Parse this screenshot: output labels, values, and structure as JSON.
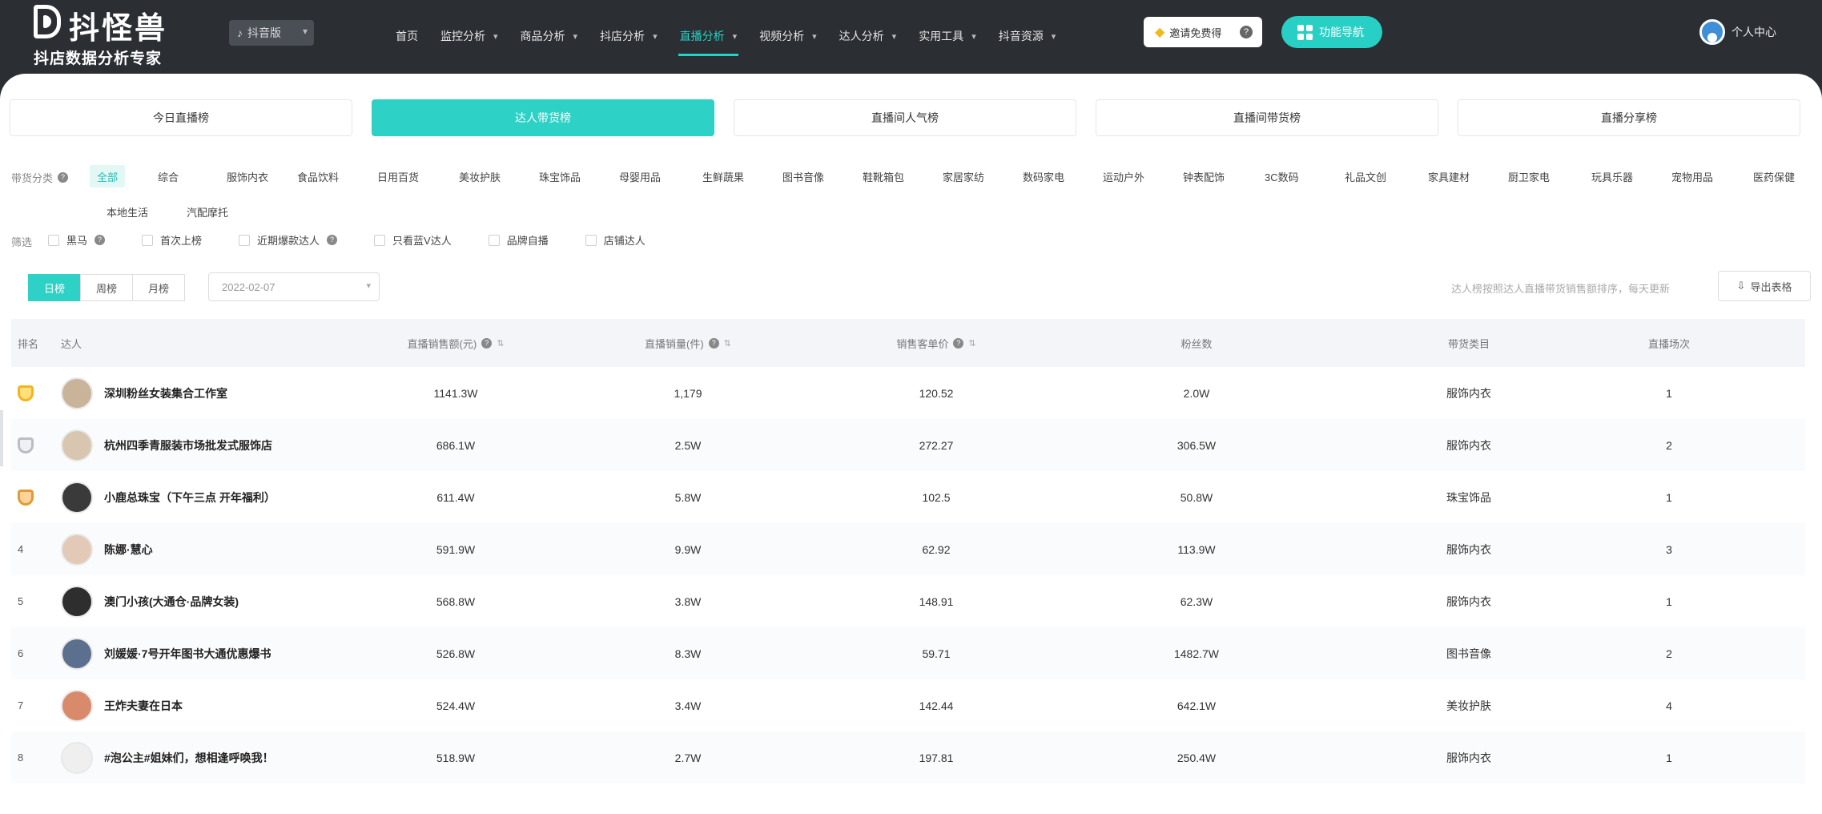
{
  "brand": {
    "name": "抖怪兽",
    "slogan": "抖店数据分析专家"
  },
  "version_select": {
    "value": "抖音版"
  },
  "nav": [
    {
      "label": "首页",
      "dropdown": false
    },
    {
      "label": "监控分析",
      "dropdown": true
    },
    {
      "label": "商品分析",
      "dropdown": true
    },
    {
      "label": "抖店分析",
      "dropdown": true
    },
    {
      "label": "直播分析",
      "dropdown": true,
      "active": true
    },
    {
      "label": "视频分析",
      "dropdown": true
    },
    {
      "label": "达人分析",
      "dropdown": true
    },
    {
      "label": "实用工具",
      "dropdown": true
    },
    {
      "label": "抖音资源",
      "dropdown": true
    }
  ],
  "invite_button": {
    "label": "邀请免费得",
    "help": "?"
  },
  "feature_button": {
    "label": "功能导航"
  },
  "user_menu": {
    "label": "个人中心"
  },
  "rank_tabs": [
    {
      "label": "今日直播榜",
      "active": false
    },
    {
      "label": "达人带货榜",
      "active": true
    },
    {
      "label": "直播间人气榜",
      "active": false
    },
    {
      "label": "直播间带货榜",
      "active": false
    },
    {
      "label": "直播分享榜",
      "active": false
    }
  ],
  "category_filter": {
    "label": "带货分类",
    "items": [
      "全部",
      "综合",
      "服饰内衣",
      "食品饮料",
      "日用百货",
      "美妆护肤",
      "珠宝饰品",
      "母婴用品",
      "生鲜蔬果",
      "图书音像",
      "鞋靴箱包",
      "家居家纺",
      "数码家电",
      "运动户外",
      "钟表配饰",
      "3C数码",
      "礼品文创",
      "家具建材",
      "厨卫家电",
      "玩具乐器",
      "宠物用品",
      "医药保健",
      "本地生活",
      "汽配摩托"
    ],
    "active_index": 0
  },
  "checkbox_filter": {
    "label": "筛选",
    "items": [
      "黑马",
      "首次上榜",
      "近期爆款达人",
      "只看蓝V达人",
      "品牌自播",
      "店铺达人"
    ]
  },
  "period_tabs": [
    {
      "label": "日榜",
      "active": true
    },
    {
      "label": "周榜",
      "active": false
    },
    {
      "label": "月榜",
      "active": false
    }
  ],
  "date_picker": {
    "value": "2022-02-07"
  },
  "note": "达人榜按照达人直播带货销售额排序，每天更新",
  "export_button": {
    "label": "导出表格"
  },
  "table": {
    "headers": {
      "rank": "排名",
      "talent": "达人",
      "sales": "直播销售额(元)",
      "volume": "直播销量(件)",
      "price": "销售客单价",
      "fans": "粉丝数",
      "category": "带货类目",
      "count": "直播场次"
    },
    "rows": [
      {
        "rank": "1",
        "medal": "gold",
        "name": "深圳粉丝女装集合工作室",
        "sales": "1141.3W",
        "volume": "1,179",
        "price": "120.52",
        "fans": "2.0W",
        "category": "服饰内衣",
        "count": "1",
        "avatar_color": "#c9b49a"
      },
      {
        "rank": "2",
        "medal": "silver",
        "name": "杭州四季青服装市场批发式服饰店",
        "sales": "686.1W",
        "volume": "2.5W",
        "price": "272.27",
        "fans": "306.5W",
        "category": "服饰内衣",
        "count": "2",
        "avatar_color": "#d8c6b0"
      },
      {
        "rank": "3",
        "medal": "bronze",
        "name": "小鹿总珠宝（下午三点 开年福利）",
        "sales": "611.4W",
        "volume": "5.8W",
        "price": "102.5",
        "fans": "50.8W",
        "category": "珠宝饰品",
        "count": "1",
        "avatar_color": "#3a3a3a"
      },
      {
        "rank": "4",
        "medal": "",
        "name": "陈娜·慧心",
        "sales": "591.9W",
        "volume": "9.9W",
        "price": "62.92",
        "fans": "113.9W",
        "category": "服饰内衣",
        "count": "3",
        "avatar_color": "#e3c9b8"
      },
      {
        "rank": "5",
        "medal": "",
        "name": "澳门小孩(大通仓·品牌女装)",
        "sales": "568.8W",
        "volume": "3.8W",
        "price": "148.91",
        "fans": "62.3W",
        "category": "服饰内衣",
        "count": "1",
        "avatar_color": "#2e2e2e"
      },
      {
        "rank": "6",
        "medal": "",
        "name": "刘媛媛·7号开年图书大通优惠爆书",
        "sales": "526.8W",
        "volume": "8.3W",
        "price": "59.71",
        "fans": "1482.7W",
        "category": "图书音像",
        "count": "2",
        "avatar_color": "#5b6f8e"
      },
      {
        "rank": "7",
        "medal": "",
        "name": "王炸夫妻在日本",
        "sales": "524.4W",
        "volume": "3.4W",
        "price": "142.44",
        "fans": "642.1W",
        "category": "美妆护肤",
        "count": "4",
        "avatar_color": "#d98a6a"
      },
      {
        "rank": "8",
        "medal": "",
        "name": "#泡公主#姐妹们，想相逢呼唤我！",
        "sales": "518.9W",
        "volume": "2.7W",
        "price": "197.81",
        "fans": "250.4W",
        "category": "服饰内衣",
        "count": "1",
        "avatar_color": "#efefef"
      }
    ]
  }
}
